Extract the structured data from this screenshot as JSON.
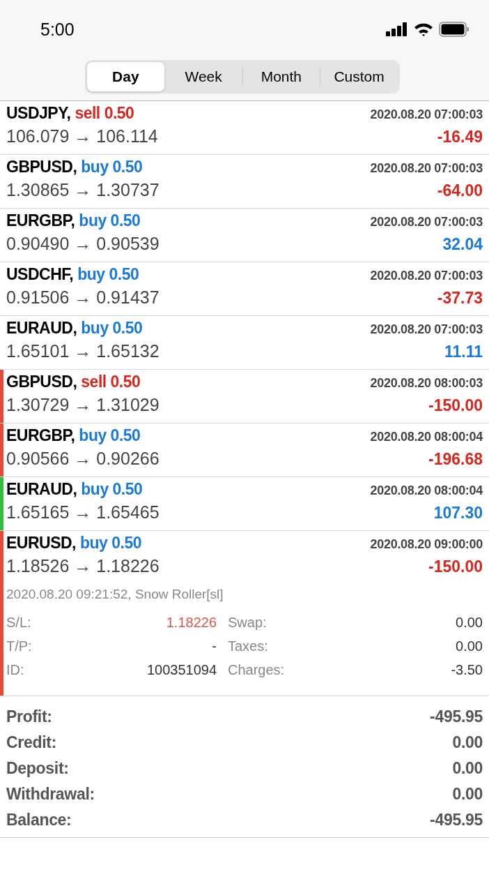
{
  "status_bar": {
    "time": "5:00"
  },
  "tabs": [
    {
      "label": "Day",
      "selected": true
    },
    {
      "label": "Week",
      "selected": false
    },
    {
      "label": "Month",
      "selected": false
    },
    {
      "label": "Custom",
      "selected": false
    }
  ],
  "trades": [
    {
      "symbol": "USDJPY,",
      "side": "sell",
      "is_sell": true,
      "lot": "0.50",
      "time": "2020.08.20 07:00:03",
      "prices": "106.079 → 106.114",
      "profit": "-16.49",
      "loss": true
    },
    {
      "symbol": "GBPUSD,",
      "side": "buy",
      "is_sell": false,
      "lot": "0.50",
      "time": "2020.08.20 07:00:03",
      "prices": "1.30865 → 1.30737",
      "profit": "-64.00",
      "loss": true
    },
    {
      "symbol": "EURGBP,",
      "side": "buy",
      "is_sell": false,
      "lot": "0.50",
      "time": "2020.08.20 07:00:03",
      "prices": "0.90490 → 0.90539",
      "profit": "32.04",
      "loss": false
    },
    {
      "symbol": "USDCHF,",
      "side": "buy",
      "is_sell": false,
      "lot": "0.50",
      "time": "2020.08.20 07:00:03",
      "prices": "0.91506 → 0.91437",
      "profit": "-37.73",
      "loss": true
    },
    {
      "symbol": "EURAUD,",
      "side": "buy",
      "is_sell": false,
      "lot": "0.50",
      "time": "2020.08.20 07:00:03",
      "prices": "1.65101 → 1.65132",
      "profit": "11.11",
      "loss": false
    },
    {
      "symbol": "GBPUSD,",
      "side": "sell",
      "is_sell": true,
      "lot": "0.50",
      "time": "2020.08.20 08:00:03",
      "prices": "1.30729 → 1.31029",
      "profit": "-150.00",
      "loss": true,
      "color": "#e5493a"
    },
    {
      "symbol": "EURGBP,",
      "side": "buy",
      "is_sell": false,
      "lot": "0.50",
      "time": "2020.08.20 08:00:04",
      "prices": "0.90566 → 0.90266",
      "profit": "-196.68",
      "loss": true,
      "color": "#e5493a"
    },
    {
      "symbol": "EURAUD,",
      "side": "buy",
      "is_sell": false,
      "lot": "0.50",
      "time": "2020.08.20 08:00:04",
      "prices": "1.65165 → 1.65465",
      "profit": "107.30",
      "loss": false,
      "color": "#2ebd3c"
    },
    {
      "symbol": "EURUSD,",
      "side": "buy",
      "is_sell": false,
      "lot": "0.50",
      "time": "2020.08.20 09:00:00",
      "prices": "1.18526 → 1.18226",
      "profit": "-150.00",
      "loss": true,
      "color": "#e5493a",
      "details": {
        "closed": "2020.08.20 09:21:52, Snow Roller[sl]",
        "rows": [
          [
            {
              "label": "S/L:",
              "value": "1.18226",
              "highlight": true
            },
            {
              "label": "Swap:",
              "value": "0.00",
              "highlight": false
            }
          ],
          [
            {
              "label": "T/P:",
              "value": "-",
              "highlight": false
            },
            {
              "label": "Taxes:",
              "value": "0.00",
              "highlight": false
            }
          ],
          [
            {
              "label": "ID:",
              "value": "100351094",
              "highlight": false
            },
            {
              "label": "Charges:",
              "value": "-3.50",
              "highlight": false
            }
          ]
        ]
      }
    }
  ],
  "summary": [
    {
      "label": "Profit:",
      "value": "-495.95"
    },
    {
      "label": "Credit:",
      "value": "0.00"
    },
    {
      "label": "Deposit:",
      "value": "0.00"
    },
    {
      "label": "Withdrawal:",
      "value": "0.00"
    },
    {
      "label": "Balance:",
      "value": "-495.95"
    }
  ]
}
